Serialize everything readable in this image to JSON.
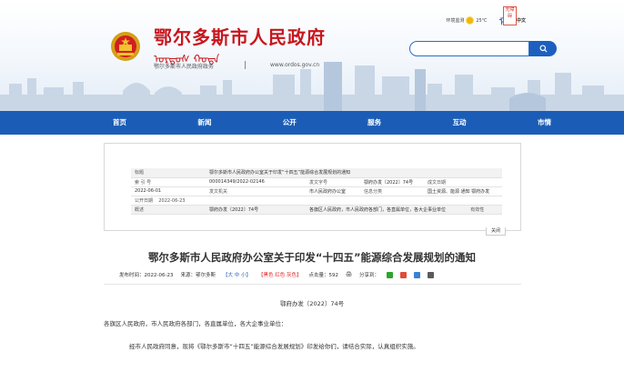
{
  "header": {
    "site_title": "鄂尔多斯市人民政府",
    "mongol_script": "ᠣᠷᠳᠣᠰ ᠬᠣᠲᠠ",
    "site_subtitle": "鄂尔多斯市人民政府政务",
    "site_url": "www.ordos.gov.cn",
    "util": {
      "weather_label": "环境监测",
      "temperature": "25℃",
      "lang_label": "中文",
      "accessibility_label": "无障碍"
    },
    "search": {
      "placeholder": ""
    }
  },
  "colors": {
    "brand_red": "#c8161d",
    "nav_blue": "#1b5db6",
    "link_blue": "#2f64b9"
  },
  "nav": {
    "items": [
      {
        "label": "首页"
      },
      {
        "label": "新闻"
      },
      {
        "label": "公开"
      },
      {
        "label": "服务"
      },
      {
        "label": "互动"
      },
      {
        "label": "市情"
      }
    ]
  },
  "info": {
    "title_label": "标题",
    "title_value": "鄂尔多斯市人民政府办公室关于印发“十四五”能源综合发展规划的通知",
    "index_label": "索 引 号",
    "index_value": "000014349/2022-02146",
    "issuer_label": "发文字号",
    "issuer_value": "鄂府办发〔2022〕74号",
    "date_label": "成文日期",
    "date_value": "2022-06-01",
    "org_label": "发文机关",
    "org_value": "市人民政府办公室",
    "category_label": "信息分类",
    "topic_value": "国土资源、能源 通知 鄂府办发",
    "public_label": "公开日期",
    "public_value": "2022-06-23",
    "summary_label": "概述",
    "summary_value": "鄂府办发〔2022〕74号",
    "summary_text": "各旗区人民政府，市人民政府各部门，各直属单位，各大企事业单位",
    "validity_label": "有效性",
    "close_label": "关闭"
  },
  "article": {
    "title": "鄂尔多斯市人民政府办公室关于印发“十四五”能源综合发展规划的通知",
    "meta": {
      "pub_time": "发布时间：2022-06-23",
      "source": "来源：鄂尔多斯",
      "font_label": "【大 中 小】",
      "color_label": "【黑色 红色 灰色】",
      "views": "点击量：592",
      "print": "🖨",
      "share_label": "分享到："
    },
    "doc_number": "鄂府办发〔2022〕74号",
    "para1": "各旗区人民政府，市人民政府各部门，各直属单位，各大企事业单位：",
    "para2": "经市人民政府同意，现将《鄂尔多斯市“十四五”能源综合发展规划》印发给你们，请结合实际，认真组织实施。"
  }
}
